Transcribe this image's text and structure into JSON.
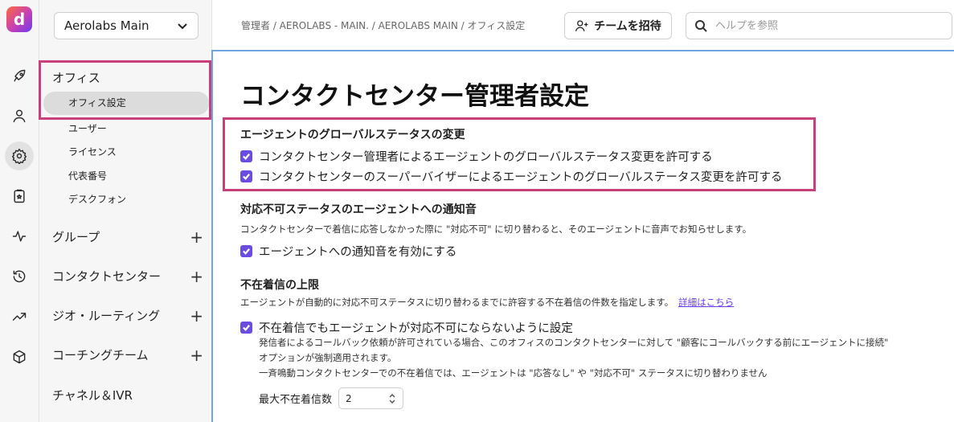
{
  "app": {
    "logo_letter": "d",
    "accent_color": "#6a4ce0",
    "highlight_color": "#c8407a"
  },
  "rail": {
    "icons": [
      "rocket-icon",
      "person-icon",
      "gear-icon",
      "clipboard-icon",
      "activity-icon",
      "history-icon",
      "trending-icon",
      "cube-icon"
    ],
    "active": "gear-icon"
  },
  "nav": {
    "workspace": "Aerolabs Main",
    "office": {
      "label": "オフィス",
      "items": [
        "オフィス設定",
        "ユーザー",
        "ライセンス",
        "代表番号",
        "デスクフォン"
      ]
    },
    "groups": [
      "グループ",
      "コンタクトセンター",
      "ジオ・ルーティング",
      "コーチングチーム",
      "チャネル＆IVR"
    ]
  },
  "topbar": {
    "breadcrumb": "管理者 / AEROLABS - MAIN. / AEROLABS MAIN / オフィス設定",
    "invite_label": "チームを招待",
    "search_placeholder": "ヘルプを参照"
  },
  "main": {
    "title": "コンタクトセンター管理者設定",
    "section1": {
      "title": "エージェントのグローバルステータスの変更",
      "options": [
        "コンタクトセンター管理者によるエージェントのグローバルステータス変更を許可する",
        "コンタクトセンターのスーパーバイザーによるエージェントのグローバルステータス変更を許可する"
      ]
    },
    "section2": {
      "title": "対応不可ステータスのエージェントへの通知音",
      "desc": "コンタクトセンターで着信に応答しなかった際に \"対応不可\" に切り替わると、そのエージェントに音声でお知らせします。",
      "option": "エージェントへの通知音を有効にする"
    },
    "section3": {
      "title": "不在着信の上限",
      "desc": "エージェントが自動的に対応不可ステータスに切り替わるまでに許容する不在着信の件数を指定します。",
      "link": "詳細はこちら",
      "option": "不在着信でもエージェントが対応不可にならないように設定",
      "notes": [
        "発信者によるコールバック依頼が許可されている場合、このオフィスのコンタクトセンターに対して \"顧客にコールバックする前にエージェントに接続\"",
        "オプションが強制適用されます。",
        "一斉鳴動コンタクトセンターでの不在着信では、エージェントは \"応答なし\" や \"対応不可\" ステータスに切り替わりません"
      ],
      "max_label": "最大不在着信数",
      "max_value": "2"
    }
  }
}
